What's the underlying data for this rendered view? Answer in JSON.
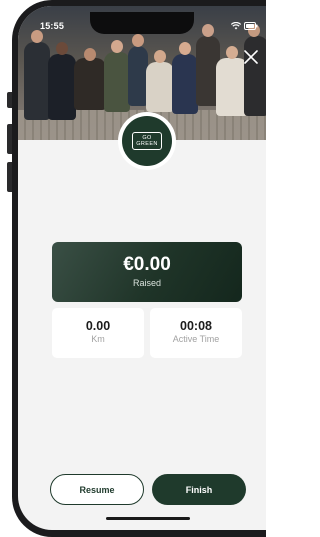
{
  "status_bar": {
    "time": "15:55"
  },
  "header": {
    "close_icon": "close-icon"
  },
  "logo": {
    "line1": "GO",
    "line2": "GREEN",
    "brand_color": "#1f3a2c"
  },
  "raised": {
    "amount": "€0.00",
    "label": "Raised"
  },
  "stats": [
    {
      "value": "0.00",
      "label": "Km"
    },
    {
      "value": "00:08",
      "label": "Active Time"
    }
  ],
  "actions": {
    "resume_label": "Resume",
    "finish_label": "Finish"
  }
}
